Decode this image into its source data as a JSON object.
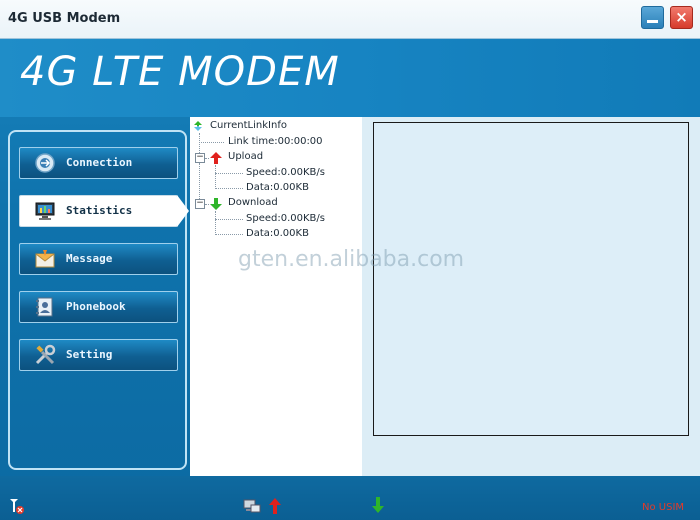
{
  "window": {
    "title": "4G USB Modem"
  },
  "banner": {
    "title": "4G LTE MODEM"
  },
  "sidebar": {
    "items": [
      {
        "label": "Connection",
        "icon": "connection-icon",
        "active": false
      },
      {
        "label": "Statistics",
        "icon": "monitor-icon",
        "active": true
      },
      {
        "label": "Message",
        "icon": "envelope-icon",
        "active": false
      },
      {
        "label": "Phonebook",
        "icon": "contact-book-icon",
        "active": false
      },
      {
        "label": "Setting",
        "icon": "tools-icon",
        "active": false
      }
    ]
  },
  "tree": {
    "root": "CurrentLinkInfo",
    "link_time": "Link time:00:00:00",
    "upload": {
      "label": "Upload",
      "speed": "Speed:0.00KB/s",
      "data": "Data:0.00KB"
    },
    "download": {
      "label": "Download",
      "speed": "Speed:0.00KB/s",
      "data": "Data:0.00KB"
    }
  },
  "watermark": "gten.en.alibaba.com",
  "statusbar": {
    "sim_status": "No USIM"
  },
  "colors": {
    "upload_arrow": "#e0211d",
    "download_arrow": "#2fb52a",
    "status_error": "#e23a2a"
  }
}
